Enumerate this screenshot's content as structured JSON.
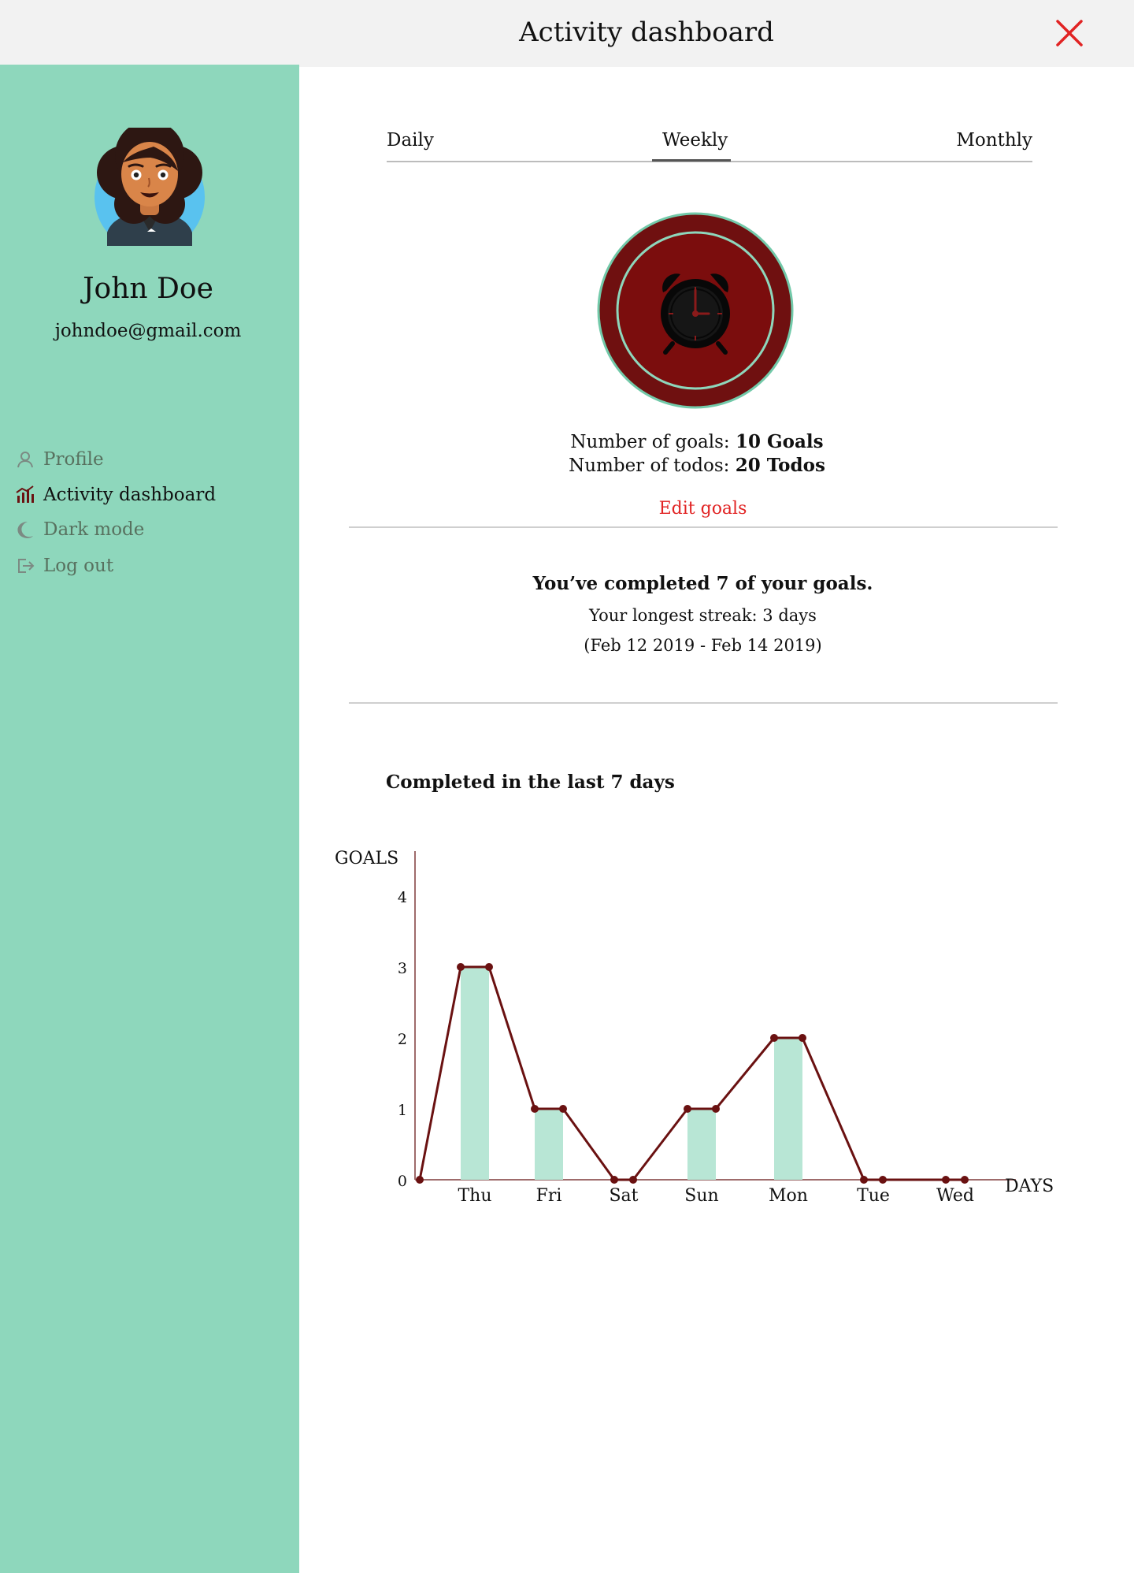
{
  "header": {
    "title": "Activity dashboard"
  },
  "profile": {
    "name": "John Doe",
    "email": "johndoe@gmail.com"
  },
  "sidebar": {
    "items": [
      {
        "label": "Profile",
        "icon": "user-icon",
        "active": false
      },
      {
        "label": "Activity dashboard",
        "icon": "bar-chart-icon",
        "active": true
      },
      {
        "label": "Dark mode",
        "icon": "moon-icon",
        "active": false
      },
      {
        "label": "Log out",
        "icon": "logout-icon",
        "active": false
      }
    ]
  },
  "tabs": [
    {
      "label": "Daily",
      "active": false
    },
    {
      "label": "Weekly",
      "active": true
    },
    {
      "label": "Monthly",
      "active": false
    }
  ],
  "stats": {
    "goals_prefix": "Number of goals:",
    "goals_value": "10 Goals",
    "todos_prefix": "Number of todos:",
    "todos_value": "20 Todos",
    "edit_goals": "Edit goals"
  },
  "summary": {
    "completed": "You’ve completed 7 of your goals.",
    "streak": "Your  longest streak: 3 days",
    "range": "(Feb 12 2019 - Feb 14 2019)"
  },
  "chart_section": {
    "title": "Completed in the last 7 days"
  },
  "colors": {
    "sidebar": "#8ed7bc",
    "accent": "#e12323",
    "badge_outer": "#6f1010",
    "badge_inner": "#7b0d0d",
    "chart_line": "#6a1111",
    "chart_bar": "#b8e6d5"
  },
  "chart_data": {
    "type": "bar",
    "categories": [
      "Thu",
      "Fri",
      "Sat",
      "Sun",
      "Mon",
      "Tue",
      "Wed"
    ],
    "values": [
      3,
      1,
      0,
      1,
      2,
      0,
      0
    ],
    "title": "",
    "xlabel": "DAYS",
    "ylabel": "GOALS",
    "ylim": [
      0,
      4
    ],
    "yticks": [
      0,
      1,
      2,
      3,
      4
    ],
    "grid": false
  }
}
